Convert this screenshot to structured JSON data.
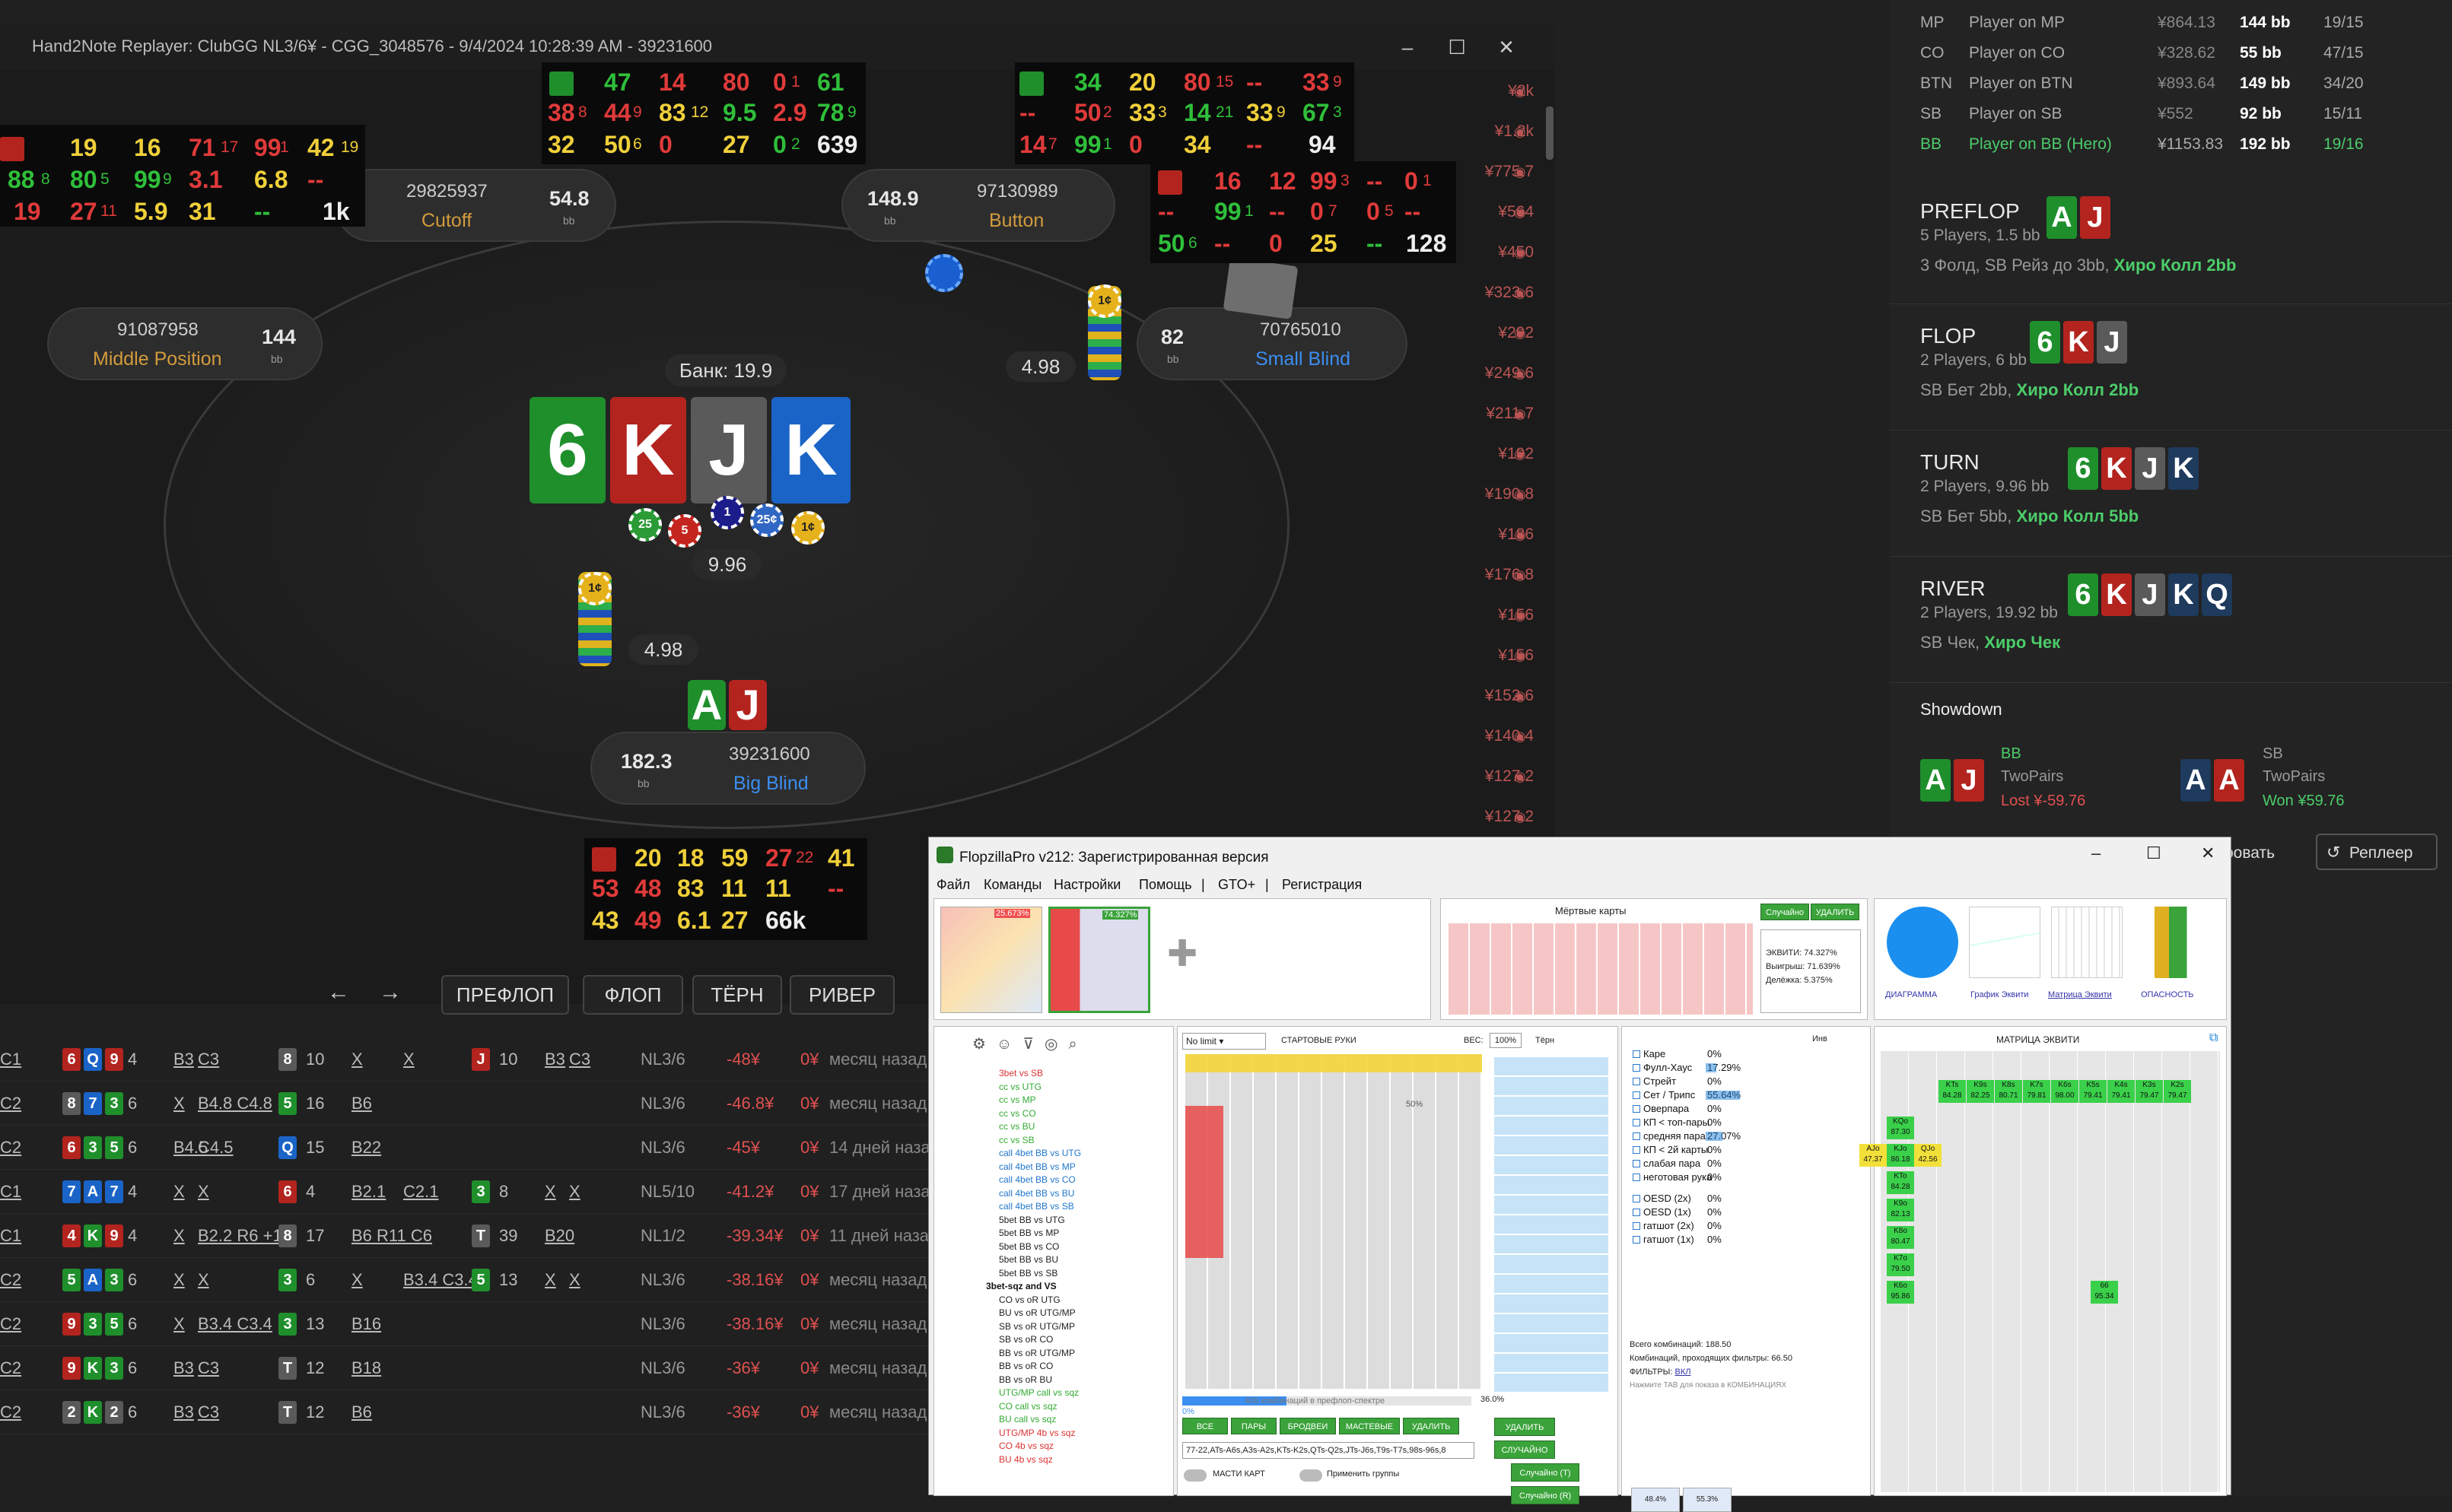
{
  "replayer": {
    "title": "Hand2Note Replayer: ClubGG NL3/6¥ - CGG_3048576 - 9/4/2024 10:28:39 AM - 39231600",
    "seats": {
      "cutoff": {
        "id": "29825937",
        "stack": "54.8",
        "bb": "bb",
        "pos": "Cutoff"
      },
      "button": {
        "id": "97130989",
        "stack": "148.9",
        "bb": "bb",
        "pos": "Button"
      },
      "mp": {
        "id": "91087958",
        "stack": "144",
        "bb": "bb",
        "pos": "Middle Position"
      },
      "sb": {
        "id": "70765010",
        "stack": "82",
        "bb": "bb",
        "pos": "Small Blind"
      },
      "bb_seat": {
        "id": "39231600",
        "stack": "182.3",
        "bb": "bb",
        "pos": "Big Blind"
      }
    },
    "pot": "Банк: 19.9",
    "board": [
      "6",
      "K",
      "J",
      "K"
    ],
    "hero_cards": [
      "A",
      "J"
    ],
    "bets": {
      "sb": "4.98",
      "bb": "4.98",
      "pot_chips": "9.96"
    },
    "chips": [
      "25",
      "5",
      "1",
      "25¢",
      "1¢",
      "1¢",
      "1¢"
    ],
    "streets": [
      "ПРЕФЛОП",
      "ФЛОП",
      "ТЁРН",
      "РИВЕР"
    ],
    "arrows": [
      "←",
      "→"
    ],
    "prices": [
      "¥2k",
      "¥1.2k",
      "¥775.7",
      "¥564",
      "¥450",
      "¥323.6",
      "¥292",
      "¥249.6",
      "¥211.7",
      "¥192",
      "¥190.8",
      "¥186",
      "¥176.8",
      "¥156",
      "¥156",
      "¥152.6",
      "¥140.4",
      "¥127.2",
      "¥127.2"
    ],
    "huds": {
      "cutoff": [
        [
          "19",
          "16",
          "71",
          "17",
          "99",
          "1",
          "42",
          "19"
        ],
        [
          "88",
          "8",
          "80",
          "5",
          "99",
          "9",
          "3.1",
          "6.8",
          "--"
        ],
        [
          "19",
          "27",
          "11",
          "5.9",
          "31",
          "--",
          "1k"
        ]
      ],
      "mp_top": [
        [
          "47",
          "14",
          "80",
          "0",
          "1",
          "61"
        ],
        [
          "38",
          "8",
          "44",
          "9",
          "83",
          "12",
          "9.5",
          "2.9",
          "78",
          "9"
        ],
        [
          "32",
          "50",
          "6",
          "0",
          "27",
          "0",
          "2",
          "639"
        ]
      ],
      "btn_top": [
        [
          "34",
          "20",
          "80",
          "15",
          "--",
          "33",
          "9"
        ],
        [
          "--",
          "50",
          "2",
          "33",
          "3",
          "14",
          "21",
          "33",
          "9",
          "67",
          "3"
        ],
        [
          "14",
          "7",
          "99",
          "1",
          "0",
          "34",
          "--",
          "94"
        ]
      ],
      "sb": [
        [
          "16",
          "12",
          "99",
          "3",
          "--",
          "0",
          "1"
        ],
        [
          "--",
          "99",
          "1",
          "--",
          "0",
          "7",
          "0",
          "5",
          "--"
        ],
        [
          "50",
          "6",
          "--",
          "0",
          "25",
          "--",
          "128"
        ]
      ],
      "hero": [
        [
          "20",
          "18",
          "59",
          "27",
          "22",
          "41"
        ],
        [
          "53",
          "48",
          "83",
          "11",
          "11",
          "--"
        ],
        [
          "43",
          "49",
          "6.1",
          "27",
          "66k"
        ]
      ]
    }
  },
  "history": [
    {
      "cards": [
        "6",
        "Q",
        "9"
      ],
      "n": "4",
      "a1": "B3",
      "a2": "C3",
      "c2": "8",
      "n2": "10",
      "a3": "X",
      "a4": "X",
      "c3": "J",
      "n3": "10",
      "a5": "B3",
      "a6": "C3",
      "lim": "NL3/6",
      "res": "-48¥",
      "z": "0¥",
      "ago": "месяц назад",
      "pos": "C1"
    },
    {
      "cards": [
        "8",
        "7",
        "3"
      ],
      "n": "6",
      "a1": "X",
      "a2": "B4.8 C4.8",
      "c2": "5",
      "n2": "16",
      "a3": "B6",
      "a4": "",
      "c3": "",
      "n3": "",
      "a5": "",
      "a6": "",
      "lim": "NL3/6",
      "res": "-46.8¥",
      "z": "0¥",
      "ago": "месяц назад",
      "pos": "C2"
    },
    {
      "cards": [
        "6",
        "3",
        "5"
      ],
      "n": "6",
      "a1": "B4.5",
      "a2": "C4.5",
      "c2": "Q",
      "n2": "15",
      "a3": "B22",
      "a4": "",
      "c3": "",
      "n3": "",
      "a5": "",
      "a6": "",
      "lim": "NL3/6",
      "res": "-45¥",
      "z": "0¥",
      "ago": "14 дней назад",
      "pos": "C2"
    },
    {
      "cards": [
        "7",
        "A",
        "7"
      ],
      "n": "4",
      "a1": "X",
      "a2": "X",
      "c2": "6",
      "n2": "4",
      "a3": "B2.1",
      "a4": "C2.1",
      "c3": "3",
      "n3": "8",
      "a5": "X",
      "a6": "X",
      "lim": "NL5/10",
      "res": "-41.2¥",
      "z": "0¥",
      "ago": "17 дней назад",
      "pos": "C1"
    },
    {
      "cards": [
        "4",
        "K",
        "9"
      ],
      "n": "4",
      "a1": "X",
      "a2": "B2.2 R6 +1",
      "c2": "8",
      "n2": "17",
      "a3": "B6 R11 C6",
      "a4": "",
      "c3": "T",
      "n3": "39",
      "a5": "B20",
      "a6": "",
      "lim": "NL1/2",
      "res": "-39.34¥",
      "z": "0¥",
      "ago": "11 дней назад",
      "pos": "C1"
    },
    {
      "cards": [
        "5",
        "A",
        "3"
      ],
      "n": "6",
      "a1": "X",
      "a2": "X",
      "c2": "3",
      "n2": "6",
      "a3": "X",
      "a4": "B3.4 C3.4",
      "c3": "5",
      "n3": "13",
      "a5": "X",
      "a6": "X",
      "lim": "NL3/6",
      "res": "-38.16¥",
      "z": "0¥",
      "ago": "месяц назад",
      "pos": "C2"
    },
    {
      "cards": [
        "9",
        "3",
        "5"
      ],
      "n": "6",
      "a1": "X",
      "a2": "B3.4 C3.4",
      "c2": "3",
      "n2": "13",
      "a3": "B16",
      "a4": "",
      "c3": "",
      "n3": "",
      "a5": "",
      "a6": "",
      "lim": "NL3/6",
      "res": "-38.16¥",
      "z": "0¥",
      "ago": "месяц назад",
      "pos": "C2"
    },
    {
      "cards": [
        "9",
        "K",
        "3"
      ],
      "n": "6",
      "a1": "B3",
      "a2": "C3",
      "c2": "T",
      "n2": "12",
      "a3": "B18",
      "a4": "",
      "c3": "",
      "n3": "",
      "a5": "",
      "a6": "",
      "lim": "NL3/6",
      "res": "-36¥",
      "z": "0¥",
      "ago": "месяц назад",
      "pos": "C2"
    },
    {
      "cards": [
        "2",
        "K",
        "2"
      ],
      "n": "6",
      "a1": "B3",
      "a2": "C3",
      "c2": "T",
      "n2": "12",
      "a3": "B6",
      "a4": "",
      "c3": "",
      "n3": "",
      "a5": "",
      "a6": "",
      "lim": "NL3/6",
      "res": "-36¥",
      "z": "0¥",
      "ago": "месяц назад",
      "pos": "C2"
    }
  ],
  "panel": {
    "players": [
      {
        "pos": "MP",
        "name": "Player on MP",
        "money": "¥864.13",
        "bb": "144 bb",
        "ratio": "19/15"
      },
      {
        "pos": "CO",
        "name": "Player on CO",
        "money": "¥328.62",
        "bb": "55 bb",
        "ratio": "47/15"
      },
      {
        "pos": "BTN",
        "name": "Player on BTN",
        "money": "¥893.64",
        "bb": "149 bb",
        "ratio": "34/20"
      },
      {
        "pos": "SB",
        "name": "Player on SB",
        "money": "¥552",
        "bb": "92 bb",
        "ratio": "15/11"
      },
      {
        "pos": "BB",
        "name": "Player on BB (Hero)",
        "money": "¥1153.83",
        "bb": "192 bb",
        "ratio": "19/16"
      }
    ],
    "preflop": {
      "name": "PREFLOP",
      "info": "5 Players, 1.5 bb",
      "act": "3 Фолд, SB Рейз до 3bb,",
      "hero": "Хиро Колл 2bb",
      "cards": [
        "A",
        "J"
      ]
    },
    "flop": {
      "name": "FLOP",
      "info": "2 Players, 6 bb",
      "act": "SB Бет 2bb,",
      "hero": "Хиро Колл 2bb",
      "cards": [
        "6",
        "K",
        "J"
      ]
    },
    "turn": {
      "name": "TURN",
      "info": "2 Players, 9.96 bb",
      "act": "SB Бет 5bb,",
      "hero": "Хиро Колл 5bb",
      "cards": [
        "6",
        "K",
        "J",
        "K"
      ]
    },
    "river": {
      "name": "RIVER",
      "info": "2 Players, 19.92 bb",
      "act": "SB Чек,",
      "hero": "Хиро Чек",
      "cards": [
        "6",
        "K",
        "J",
        "K",
        "Q"
      ]
    },
    "showdown": {
      "title": "Showdown",
      "bb_pos": "BB",
      "bb_hand": "TwoPairs",
      "bb_res": "Lost ¥-59.76",
      "sb_pos": "SB",
      "sb_hand": "TwoPairs",
      "sb_res": "Won ¥59.76",
      "bb_cards": [
        "A",
        "J"
      ],
      "sb_cards": [
        "A",
        "A"
      ]
    },
    "buttons": {
      "save": "ровать",
      "replayer": "Реплеер"
    }
  },
  "flopzilla": {
    "title": "FlopzillaPro v212: Зарегистрированная версия",
    "menu": [
      "Файл",
      "Команды",
      "Настройки",
      "Помощь",
      "|",
      "GTO+",
      "|",
      "Регистрация"
    ],
    "range1_pct": "25.673%",
    "range2_pct": "74.327%",
    "dead_cards": "Мёртвые карты",
    "random_btn": "Случайно",
    "delete_btn": "УДАЛИТЬ",
    "equity": "ЭКВИТИ: 74.327%",
    "wins": "Выигрыш: 71.639%",
    "split": "Делёжка: 5.375%",
    "tabs": [
      "ДИАГРАММА",
      "График Эквити",
      "Матрица Эквити",
      "ОПАСНОСТЬ"
    ],
    "nolimit": "No limit",
    "start_hands": "СТАРТОВЫЕ РУКИ",
    "weight": "ВЕС:",
    "weight_val": "100%",
    "turn_label": "Тёрн",
    "inv": "Инв",
    "combo_count": "406 комбинаций в префлоп-спектре",
    "pct_36": "36.0%",
    "pct_0": "0%",
    "pct_50": "50%",
    "range_btns": [
      "ВСЕ",
      "ПАРЫ",
      "БРОДВЕИ",
      "МАСТЕВЫЕ",
      "УДАЛИТЬ"
    ],
    "range_text": "77-22,ATs-A6s,A3s-A2s,KTs-K2s,QTs-Q2s,JTs-J6s,T9s-T7s,98s-96s,8",
    "suits": "МАСТИ КАРТ",
    "apply_groups": "Применить группы",
    "side_btns": [
      "УДАЛИТЬ",
      "СЛУЧАЙНО",
      "Случайно (T)",
      "Случайно (R)"
    ],
    "stats": [
      {
        "l": "Каре",
        "v": "0%"
      },
      {
        "l": "Фулл-Хаус",
        "v": "17.29%"
      },
      {
        "l": "Стрейт",
        "v": "0%"
      },
      {
        "l": "Сет / Трипс",
        "v": "55.64%"
      },
      {
        "l": "Оверпара",
        "v": "0%"
      },
      {
        "l": "КП < топ-пары",
        "v": "0%"
      },
      {
        "l": "средняя пара",
        "v": "27.07%"
      },
      {
        "l": "КП < 2й карты",
        "v": "0%"
      },
      {
        "l": "слабая пара",
        "v": "0%"
      },
      {
        "l": "неготовая рука",
        "v": "0%"
      },
      {
        "l": "OESD (2х)",
        "v": "0%"
      },
      {
        "l": "OESD (1х)",
        "v": "0%"
      },
      {
        "l": "гатшот (2х)",
        "v": "0%"
      },
      {
        "l": "гатшот (1х)",
        "v": "0%"
      }
    ],
    "total_combos": "Всего комбинаций: 188.50",
    "filtered": "Комбинаций, проходящих фильтры: 66.50",
    "filters": "ФИЛЬТРЫ:",
    "filters_on": "ВКЛ",
    "hint": "Нажмите TAB для показа в КОМБИНАЦИЯХ",
    "matrix_title": "МАТРИЦА ЭКВИТИ",
    "filt_pct1": "48.4%",
    "filt_pct2": "55.3%",
    "tree": [
      {
        "t": "3bet vs SB",
        "c": "#d33"
      },
      {
        "t": "cc vs UTG",
        "c": "#3a3"
      },
      {
        "t": "cc vs MP",
        "c": "#3a3"
      },
      {
        "t": "cc vs CO",
        "c": "#3a3"
      },
      {
        "t": "cc vs BU",
        "c": "#3a3"
      },
      {
        "t": "cc vs SB",
        "c": "#3a3"
      },
      {
        "t": "call 4bet BB vs UTG",
        "c": "#27c"
      },
      {
        "t": "call 4bet BB vs MP",
        "c": "#27c"
      },
      {
        "t": "call 4bet BB vs CO",
        "c": "#27c"
      },
      {
        "t": "call 4bet BB vs BU",
        "c": "#27c"
      },
      {
        "t": "call 4bet BB vs SB",
        "c": "#27c"
      },
      {
        "t": "5bet BB vs UTG",
        "c": "#222"
      },
      {
        "t": "5bet BB vs MP",
        "c": "#222"
      },
      {
        "t": "5bet BB vs CO",
        "c": "#222"
      },
      {
        "t": "5bet BB vs BU",
        "c": "#222"
      },
      {
        "t": "5bet BB vs SB",
        "c": "#222"
      },
      {
        "t": "3bet-sqz and VS",
        "c": "#111"
      },
      {
        "t": "CO vs oR UTG",
        "c": "#222"
      },
      {
        "t": "BU vs oR UTG/MP",
        "c": "#222"
      },
      {
        "t": "SB vs oR UTG/MP",
        "c": "#222"
      },
      {
        "t": "SB vs oR CO",
        "c": "#222"
      },
      {
        "t": "BB vs oR UTG/MP",
        "c": "#222"
      },
      {
        "t": "BB vs oR CO",
        "c": "#222"
      },
      {
        "t": "BB vs oR BU",
        "c": "#222"
      },
      {
        "t": "UTG/MP call vs sqz",
        "c": "#3a3"
      },
      {
        "t": "CO call vs sqz",
        "c": "#3a3"
      },
      {
        "t": "BU call vs sqz",
        "c": "#3a3"
      },
      {
        "t": "UTG/MP 4b vs sqz",
        "c": "#d33"
      },
      {
        "t": "CO 4b vs sqz",
        "c": "#d33"
      },
      {
        "t": "BU 4b vs sqz",
        "c": "#d33"
      }
    ],
    "eq_rows": [
      {
        "h": "",
        "vals": [
          "KTs 84.28",
          "K9s 82.25",
          "K8s 80.71",
          "K7s 79.81",
          "K6s 98.00",
          "K5s 79.41",
          "K4s 79.41",
          "K3s 79.47",
          "K2s 79.47"
        ]
      },
      {
        "h": "KQo 87.30",
        "vals": []
      },
      {
        "h": "KJo 86.18",
        "vals": [
          "QJo 42.56"
        ],
        "a": "AJo 47.37"
      },
      {
        "h": "KTo 84.28",
        "vals": []
      },
      {
        "h": "K9o 82.13",
        "vals": []
      },
      {
        "h": "K8o 80.47",
        "vals": []
      },
      {
        "h": "K7o 79.50",
        "vals": []
      },
      {
        "h": "K6o 95.86",
        "vals": [
          "66 95.34"
        ]
      }
    ],
    "colors": {
      "green": "#3aa33a",
      "yellow": "#f2e03a",
      "blue": "#1a7fd9",
      "red": "#e04040"
    }
  }
}
